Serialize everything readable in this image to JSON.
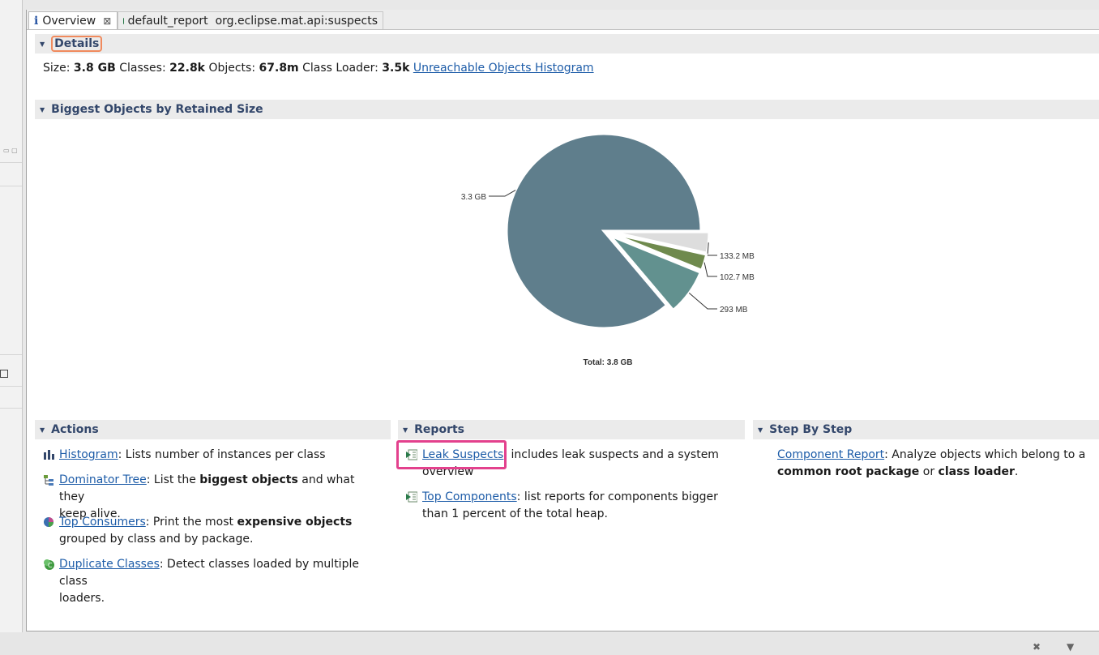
{
  "tabs": [
    {
      "label": "Overview",
      "close": "⊠"
    },
    {
      "label": "default_report  org.eclipse.mat.api:suspects"
    }
  ],
  "details": {
    "title": "Details",
    "size_label": "Size:",
    "size_value": "3.8 GB",
    "classes_label": "Classes:",
    "classes_value": "22.8k",
    "objects_label": "Objects:",
    "objects_value": "67.8m",
    "loader_label": "Class Loader:",
    "loader_value": "3.5k",
    "histogram_link": "Unreachable Objects Histogram"
  },
  "biggest": {
    "title": "Biggest Objects by Retained Size"
  },
  "chart_data": {
    "type": "pie",
    "slices": [
      {
        "label": "3.3 GB",
        "value": 3.3,
        "color": "#5f7e8c"
      },
      {
        "label": "293 MB",
        "value": 0.293,
        "color": "#62918f"
      },
      {
        "label": "102.7 MB",
        "value": 0.1027,
        "color": "#6f8a4d"
      },
      {
        "label": "133.2 MB",
        "value": 0.1332,
        "color": "#dddddd"
      }
    ],
    "total_label": "Total: 3.8 GB"
  },
  "actions": {
    "title": "Actions",
    "items": [
      {
        "link": "Histogram",
        "text": ": Lists number of instances per class"
      },
      {
        "link": "Dominator Tree",
        "pre": ": List the ",
        "bold": "biggest objects",
        "post": " and what they",
        "line2": "keep alive."
      },
      {
        "link": "Top Consumers",
        "pre": ": Print the most ",
        "bold": "expensive objects",
        "line2": "grouped by class and by package."
      },
      {
        "link": "Duplicate Classes",
        "text": ": Detect classes loaded by multiple class",
        "line2": "loaders."
      }
    ]
  },
  "reports": {
    "title": "Reports",
    "items": [
      {
        "link": "Leak Suspects",
        "text": ": includes leak suspects and a system",
        "line2": "overview"
      },
      {
        "link": "Top Components",
        "text": ": list reports for components bigger",
        "line2": "than 1 percent of the total heap."
      }
    ]
  },
  "stepbystep": {
    "title": "Step By Step",
    "link": "Component Report",
    "text": ": Analyze objects which belong to a",
    "bold1": "common root package",
    "mid": " or ",
    "bold2": "class loader",
    "end": "."
  }
}
